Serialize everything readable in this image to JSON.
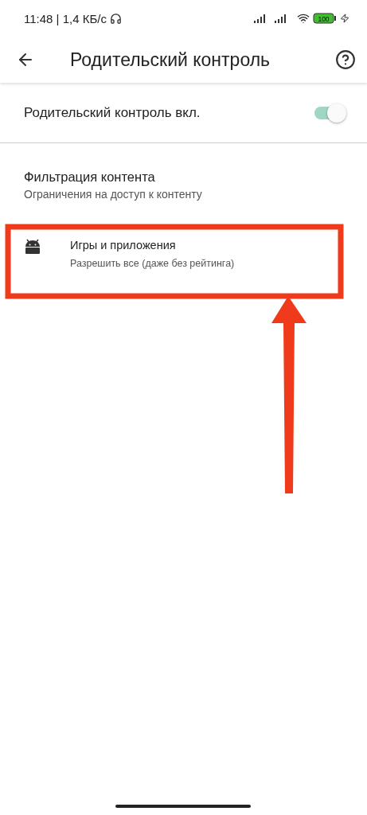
{
  "status_bar": {
    "time": "11:48 | 1,4 КБ/с",
    "battery": "100"
  },
  "toolbar": {
    "title": "Родительский контроль"
  },
  "switch_row": {
    "label": "Родительский контроль вкл.",
    "on": true
  },
  "section": {
    "title": "Фильтрация контента",
    "subtitle": "Ограничения на доступ к контенту"
  },
  "items": [
    {
      "title": "Игры и приложения",
      "subtitle": "Разрешить все (даже без рейтинга)"
    }
  ]
}
